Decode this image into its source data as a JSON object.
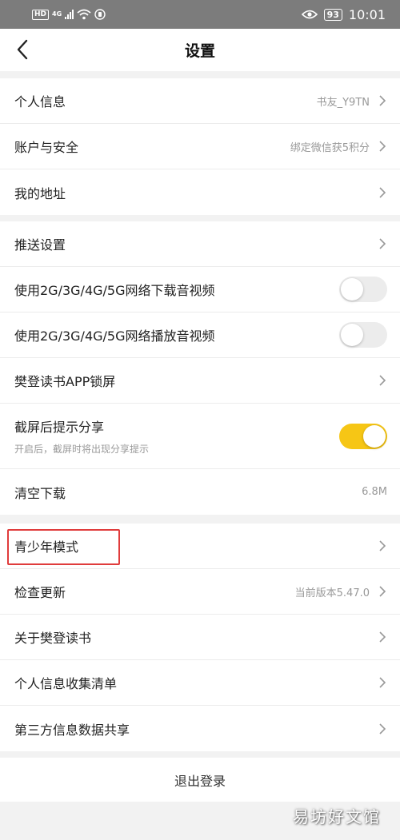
{
  "status_bar": {
    "hd": "HD",
    "network": "4G",
    "battery": "93",
    "time": "10:01"
  },
  "nav": {
    "title": "设置"
  },
  "group1": [
    {
      "label": "个人信息",
      "value": "书友_Y9TN"
    },
    {
      "label": "账户与安全",
      "value": "绑定微信获5积分"
    },
    {
      "label": "我的地址",
      "value": ""
    }
  ],
  "group2": [
    {
      "label": "推送设置"
    },
    {
      "label": "使用2G/3G/4G/5G网络下载音视频",
      "toggle": false
    },
    {
      "label": "使用2G/3G/4G/5G网络播放音视频",
      "toggle": false
    },
    {
      "label": "樊登读书APP锁屏"
    },
    {
      "label": "截屏后提示分享",
      "sub": "开启后，截屏时将出现分享提示",
      "toggle": true
    },
    {
      "label": "清空下载",
      "value": "6.8M"
    }
  ],
  "group3": [
    {
      "label": "青少年模式"
    },
    {
      "label": "检查更新",
      "value": "当前版本5.47.0"
    },
    {
      "label": "关于樊登读书"
    },
    {
      "label": "个人信息收集清单"
    },
    {
      "label": "第三方信息数据共享"
    }
  ],
  "logout_label": "退出登录",
  "watermark": "易坊好文馆",
  "colors": {
    "accent_toggle": "#f6c615",
    "highlight": "#e03c3c",
    "status_bar": "#7c7c7c"
  }
}
